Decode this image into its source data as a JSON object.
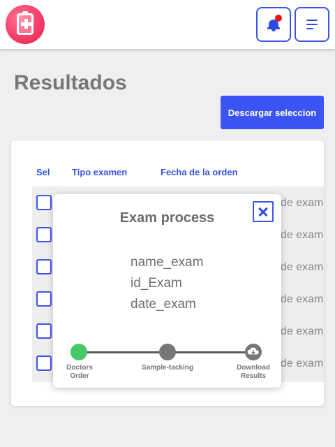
{
  "header": {
    "logo_icon": "medical-clipboard-icon",
    "notification_icon": "bell-icon",
    "notification_badge_color": "#e11111",
    "menu_icon": "hamburger-menu-icon",
    "accent_color": "#3b55e6"
  },
  "page": {
    "title": "Resultados",
    "download_button": "Descargar seleccion"
  },
  "table": {
    "columns": [
      "Sel",
      "Tipo examen",
      "Fecha de la orden"
    ],
    "rows": [
      {
        "selected": false,
        "cell": "de examen"
      },
      {
        "selected": false,
        "cell": "de examen"
      },
      {
        "selected": false,
        "cell": "de examen"
      },
      {
        "selected": false,
        "cell": "de examen"
      },
      {
        "selected": false,
        "cell": "de examen"
      },
      {
        "selected": false,
        "cell": "de examen"
      }
    ]
  },
  "modal": {
    "title": "Exam process",
    "close_icon": "close-icon",
    "fields": [
      "name_exam",
      "id_Exam",
      "date_exam"
    ],
    "steps": [
      {
        "label_line1": "Doctors",
        "label_line2": "Order",
        "status": "completed",
        "color": "#47c768"
      },
      {
        "label_line1": "Sample-tacking",
        "label_line2": "",
        "status": "pending",
        "color": "#777777"
      },
      {
        "label_line1": "Download",
        "label_line2": "Results",
        "status": "pending",
        "color": "#777777",
        "icon": "cloud-download-icon"
      }
    ]
  }
}
